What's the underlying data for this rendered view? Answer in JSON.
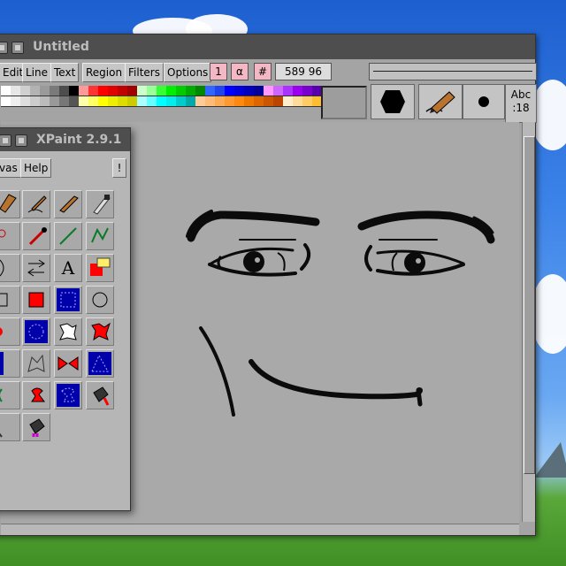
{
  "main_window": {
    "title": "Untitled",
    "menu": [
      "Edit",
      "Line",
      "Text",
      "Region",
      "Filters",
      "Options"
    ],
    "pink_buttons": [
      "1",
      "α",
      "#"
    ],
    "coords": "589 96",
    "font_label_1": "Abc",
    "font_label_2": ":18"
  },
  "tool_window": {
    "title": "XPaint 2.9.1",
    "menu": [
      "vas",
      "Help"
    ],
    "alert": "!",
    "text_tool": "A"
  },
  "palette_row1": [
    "#ffffff",
    "#e6e6e6",
    "#cfcfcf",
    "#b3b3b3",
    "#9a9a9a",
    "#7a7a7a",
    "#4d4d4d",
    "#000000",
    "#ff9999",
    "#ff3333",
    "#ff0000",
    "#e00000",
    "#c00000",
    "#a00000",
    "#ccffcc",
    "#99ff99",
    "#33ff33",
    "#00ee00",
    "#00cc00",
    "#00aa00",
    "#008800",
    "#3366ff",
    "#2244ee",
    "#0000ff",
    "#0000dd",
    "#0000bb",
    "#000099",
    "#ff99ff",
    "#cc66ff",
    "#aa33ff",
    "#9900ee",
    "#7700cc",
    "#5500aa"
  ],
  "palette_row2": [
    "#ffffff",
    "#eeeeee",
    "#dddddd",
    "#cccccc",
    "#bbbbbb",
    "#999999",
    "#777777",
    "#555555",
    "#ffffaa",
    "#ffff66",
    "#ffff00",
    "#eeee00",
    "#dddd00",
    "#cccc00",
    "#aaffff",
    "#66ffff",
    "#00ffff",
    "#00eeee",
    "#00cccc",
    "#00aaaa",
    "#ffcc99",
    "#ffbb77",
    "#ffaa55",
    "#ff9933",
    "#ff8811",
    "#ee7700",
    "#dd6600",
    "#cc5500",
    "#bb4400",
    "#ffeecc",
    "#ffdd99",
    "#ffcc66",
    "#ffbb33"
  ]
}
